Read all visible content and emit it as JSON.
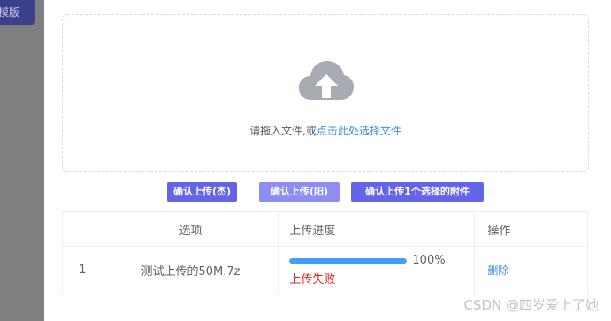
{
  "background": {
    "button_label": "模版"
  },
  "dropzone": {
    "prompt": "请拖入文件,或",
    "link": "点击此处选择文件"
  },
  "buttons": {
    "upload_a": "确认上传(杰)",
    "upload_b": "确认上传(阳)",
    "upload_selected": "确认上传1个选择的附件"
  },
  "table": {
    "headers": [
      "",
      "选项",
      "上传进度",
      "操作"
    ],
    "rows": [
      {
        "index": "1",
        "name": "测试上传的50M.7z",
        "progress": 100,
        "progress_label": "100%",
        "status": "上传失败",
        "action": "删除"
      }
    ]
  },
  "watermark": "CSDN @四岁爱上了她",
  "colors": {
    "primary_button": "#6364e6",
    "disabled_button": "#8e8ef2",
    "link": "#3a8ee6",
    "progress": "#409eff",
    "error": "#e02020"
  }
}
